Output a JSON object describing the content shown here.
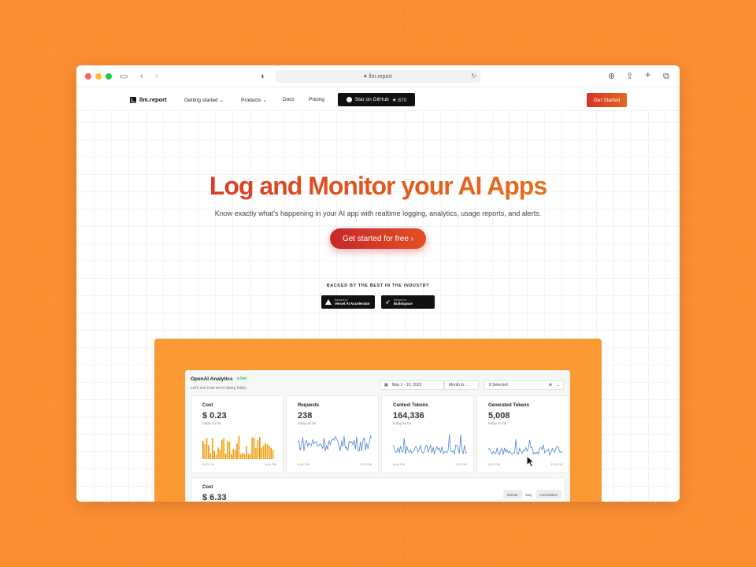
{
  "browser": {
    "url": "llm.report"
  },
  "nav": {
    "brand": "llm.report",
    "links": [
      "Getting started ⌄",
      "Products ⌄",
      "Docs",
      "Pricing"
    ],
    "github_label": "Star on GitHub",
    "github_stars": "★ 870",
    "cta": "Get Started"
  },
  "hero": {
    "title": "Log and Monitor your AI Apps",
    "subtitle": "Know exactly what's happening in your AI app with realtime logging, analytics, usage reports, and alerts.",
    "button": "Get started for free ›",
    "backed_title": "BACKED BY THE BEST IN THE INDUSTRY",
    "badges": [
      {
        "small": "Backed by",
        "large": "Vercel AI Accelerator"
      },
      {
        "small": "Backed by",
        "large": "Buildspace"
      }
    ]
  },
  "dashboard": {
    "title": "OpenAI Analytics",
    "live": "live",
    "subtitle": "Let's see how we're doing today",
    "date_range": "May 1 - 10, 2023",
    "period": "Month to ...",
    "selected": "8 Selected",
    "cards": [
      {
        "title": "Cost",
        "value": "$ 0.23",
        "sub": "today so far",
        "start": "8:40 PM",
        "end": "3:05 PM",
        "color": "#f2a300"
      },
      {
        "title": "Requests",
        "value": "238",
        "sub": "today so far",
        "start": "8:40 PM",
        "end": "3:05 PM",
        "color": "#4f86d6"
      },
      {
        "title": "Context Tokens",
        "value": "164,336",
        "sub": "today so far",
        "start": "8:40 PM",
        "end": "3:05 PM",
        "color": "#4f86d6"
      },
      {
        "title": "Generated Tokens",
        "value": "5,008",
        "sub": "today so far",
        "start": "8:40 PM",
        "end": "3:05 PM",
        "color": "#4f86d6"
      }
    ],
    "cost_card": {
      "title": "Cost",
      "value": "$ 6.33",
      "segments": [
        "Minute",
        "Day",
        "Cumulative"
      ]
    }
  }
}
